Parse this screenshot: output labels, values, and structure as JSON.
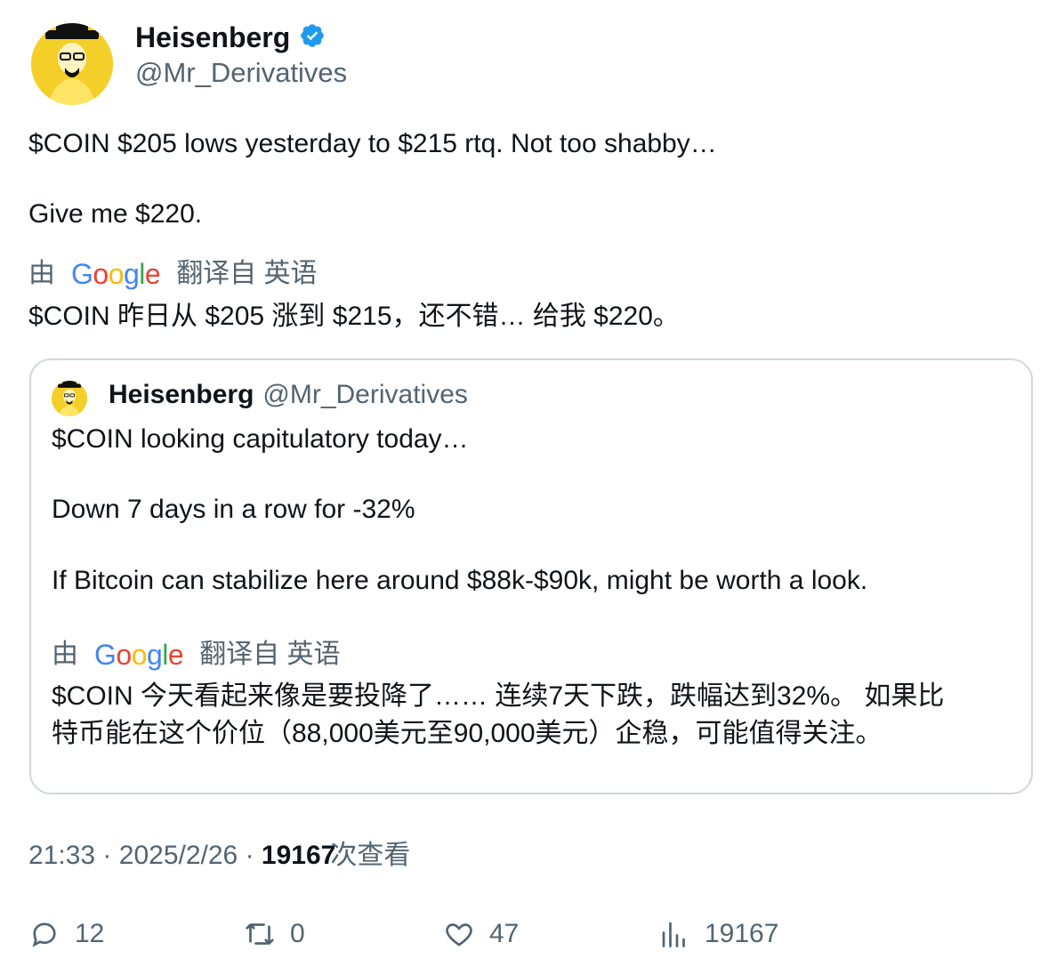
{
  "author": {
    "name": "Heisenberg",
    "handle": "@Mr_Derivatives",
    "verified_color": "#1d9bf0"
  },
  "tweet": {
    "line1": "$COIN $205 lows yesterday to $215 rtq. Not too shabby…",
    "line2": "Give me $220.",
    "translate_prefix": "由",
    "translate_brand": "Google",
    "translate_suffix": "翻译自 英语",
    "translation": "$COIN 昨日从 $205 涨到 $215，还不错… 给我 $220。"
  },
  "quote": {
    "name": "Heisenberg",
    "handle": "@Mr_Derivatives",
    "line1": "$COIN looking capitulatory today…",
    "line2": "Down 7 days in a row for -32%",
    "line3": "If Bitcoin can stabilize here around $88k-$90k, might be worth a look.",
    "translate_prefix": "由",
    "translate_brand": "Google",
    "translate_suffix": "翻译自 英语",
    "translation_line1": "$COIN 今天看起来像是要投降了…… 连续7天下跌，跌幅达到32%。 如果比",
    "translation_line2": "特币能在这个价位（88,000美元至90,000美元）企稳，可能值得关注。"
  },
  "meta": {
    "time": "21:33",
    "separator": "·",
    "date": "2025/2/26",
    "views_count": "19167",
    "views_label": "次查看"
  },
  "actions": {
    "replies": "12",
    "retweets": "0",
    "likes": "47",
    "views": "19167"
  }
}
